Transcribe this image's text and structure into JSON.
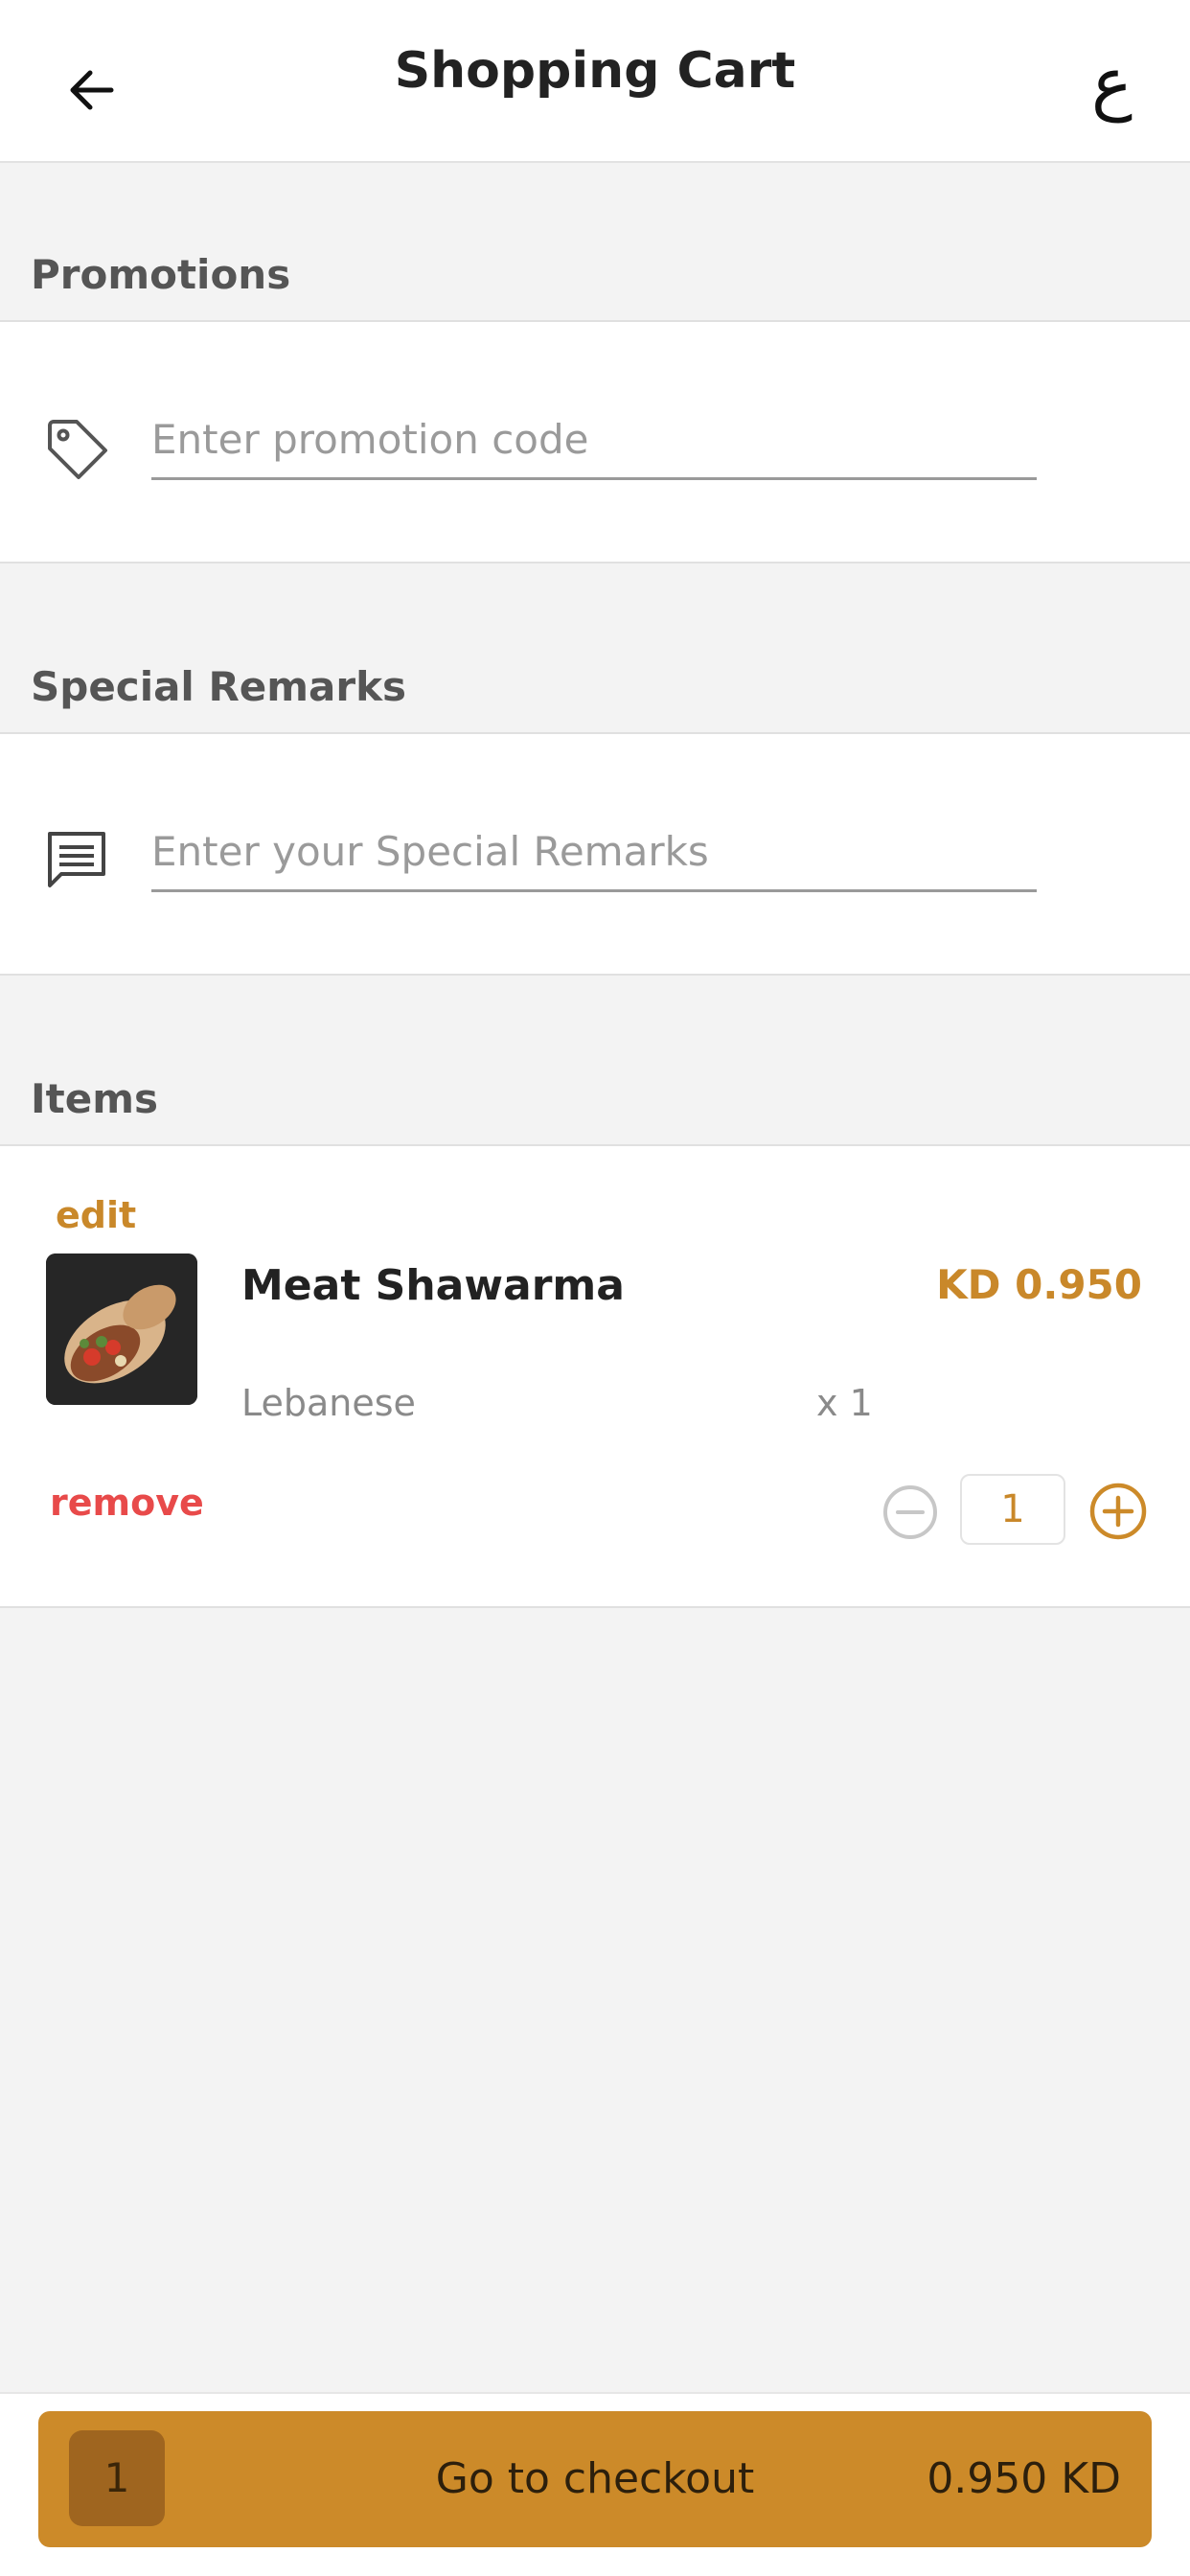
{
  "header": {
    "title": "Shopping Cart",
    "language_toggle": "ع",
    "back_icon": "arrow-left-icon"
  },
  "promotions": {
    "section_title": "Promotions",
    "input_placeholder": "Enter promotion code",
    "input_value": "",
    "icon": "tag-icon"
  },
  "remarks": {
    "section_title": "Special Remarks",
    "input_placeholder": "Enter your Special Remarks",
    "input_value": "",
    "icon": "message-icon"
  },
  "items": {
    "section_title": "Items",
    "list": [
      {
        "edit_label": "edit",
        "name": "Meat Shawarma",
        "price": "KD 0.950",
        "subtitle": "Lebanese",
        "quantity_label": "x 1",
        "remove_label": "remove",
        "quantity": "1"
      }
    ]
  },
  "footer": {
    "cart_count": "1",
    "checkout_label": "Go to checkout",
    "total": "0.950 KD"
  },
  "colors": {
    "accent": "#cc8a29",
    "remove": "#e84a4a",
    "background": "#f3f3f3"
  }
}
